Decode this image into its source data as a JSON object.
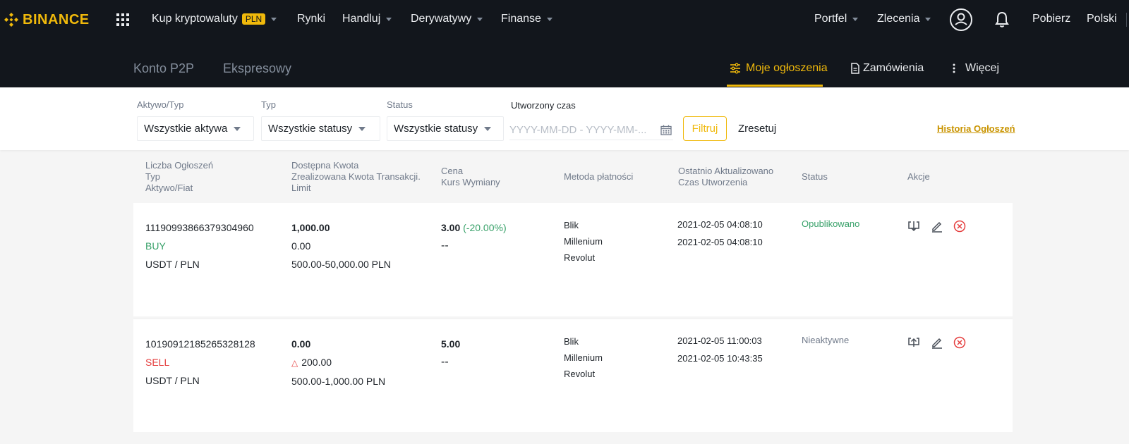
{
  "brand": {
    "name": "BINANCE",
    "accent": "#f0b90b",
    "nav_bg": "#12161c"
  },
  "topnav": {
    "items": [
      {
        "label": "Kup kryptowaluty",
        "badge": "PLN"
      },
      {
        "label": "Rynki"
      },
      {
        "label": "Handluj"
      },
      {
        "label": "Derywatywy"
      },
      {
        "label": "Finanse"
      }
    ],
    "right": {
      "wallet": "Portfel",
      "orders": "Zlecenia",
      "download": "Pobierz",
      "language": "Polski"
    },
    "icons": [
      "apps-grid-icon",
      "profile-icon",
      "bell-icon"
    ]
  },
  "subnav": {
    "tabs": [
      "Konto P2P",
      "Ekspresowy"
    ],
    "right_tabs": [
      "Moje ogłoszenia",
      "Zamówienia",
      "Więcej"
    ],
    "active": "Moje ogłoszenia"
  },
  "filters": {
    "asset_label": "Aktywo/Typ",
    "asset_value": "Wszystkie aktywa",
    "type_label": "Typ",
    "type_value": "Wszystkie statusy",
    "status_label": "Status",
    "status_value": "Wszystkie statusy",
    "created_label": "Utworzony czas",
    "date_placeholder": "YYYY-MM-DD - YYYY-MM-...",
    "filter_button": "Filtruj",
    "reset_button": "Zresetuj",
    "history_link": "Historia Ogłoszeń"
  },
  "table": {
    "headers": {
      "col1": [
        "Liczba Ogłoszeń",
        "Typ",
        "Aktywo/Fiat"
      ],
      "col2": [
        "Dostępna Kwota",
        "Zrealizowana Kwota Transakcji.",
        "Limit"
      ],
      "col3": [
        "Cena",
        "Kurs Wymiany"
      ],
      "col4": "Metoda płatności",
      "col5": [
        "Ostatnio Aktualizowano",
        "Czas Utworzenia"
      ],
      "col6": "Status",
      "col7": "Akcje"
    },
    "rows": [
      {
        "id": "11190993866379304960",
        "side": "BUY",
        "pair": "USDT / PLN",
        "available": "1,000.00",
        "completed": "0.00",
        "limit": "500.00-50,000.00 PLN",
        "price": "3.00",
        "price_change": "(-20.00%)",
        "rate": "--",
        "payments": [
          "Blik",
          "Millenium",
          "Revolut"
        ],
        "updated": "2021-02-05 04:08:10",
        "created": "2021-02-05 04:08:10",
        "status": "Opublikowano"
      },
      {
        "id": "10190912185265328128",
        "side": "SELL",
        "pair": "USDT / PLN",
        "available": "0.00",
        "completed": "200.00",
        "limit": "500.00-1,000.00 PLN",
        "price": "5.00",
        "rate": "--",
        "payments": [
          "Blik",
          "Millenium",
          "Revolut"
        ],
        "updated": "2021-02-05 11:00:03",
        "created": "2021-02-05 10:43:35",
        "status": "Nieaktywne"
      }
    ],
    "actions": [
      "unpublish-icon",
      "edit-icon",
      "close-icon"
    ]
  }
}
